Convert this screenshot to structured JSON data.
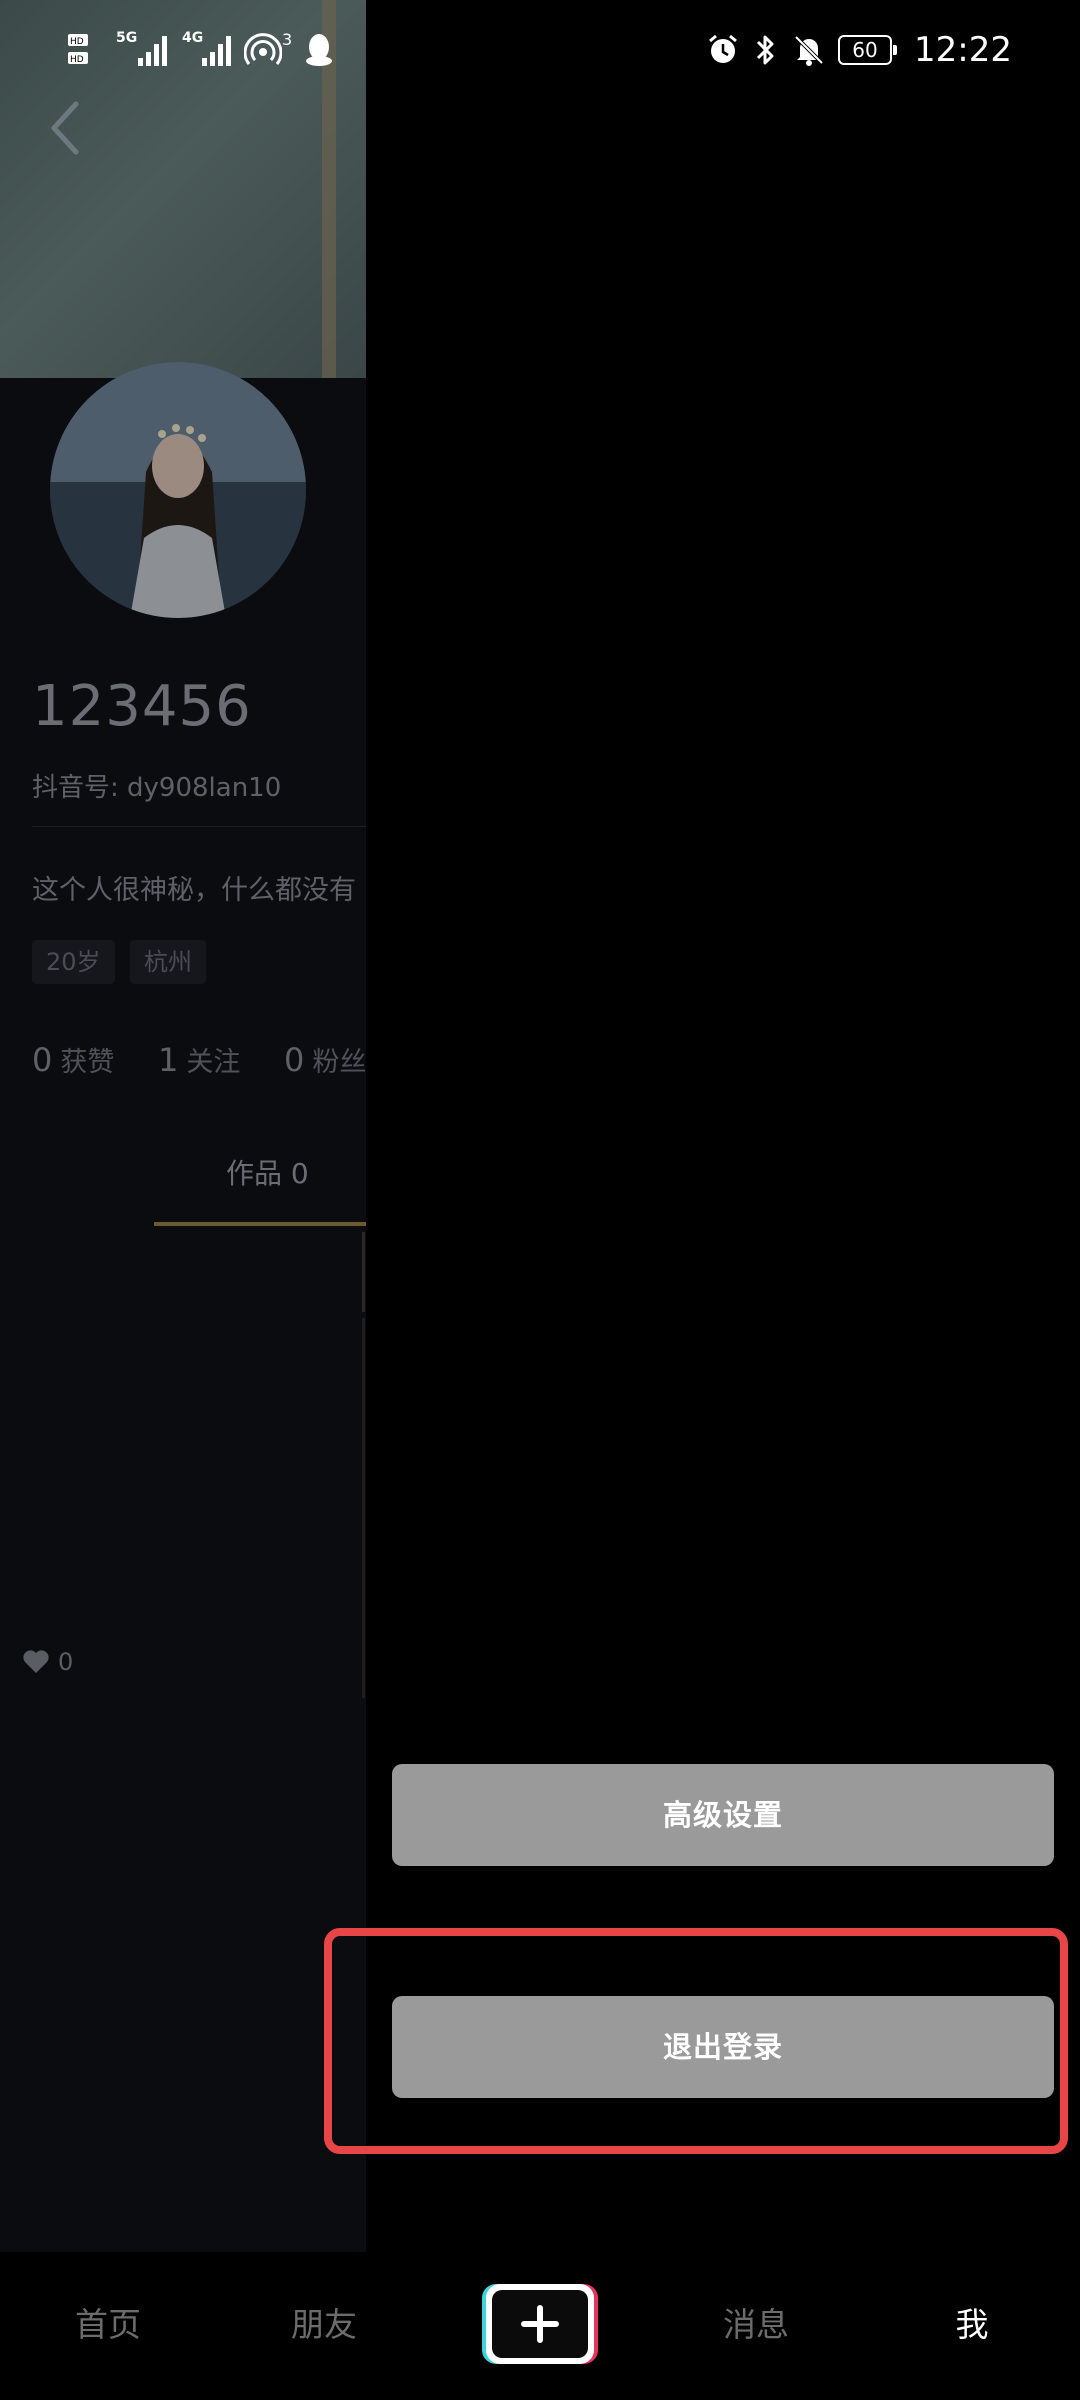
{
  "status_bar": {
    "time": "12:22",
    "battery": "60",
    "network_1": "5G",
    "network_2": "4G",
    "hotspot_count": "3"
  },
  "profile": {
    "username": "123456",
    "douyin_id": "抖音号: dy908lan10",
    "bio": "这个人很神秘，什么都没有",
    "tags": [
      "20岁",
      "杭州"
    ],
    "stats": [
      {
        "num": "0",
        "label": "获赞"
      },
      {
        "num": "1",
        "label": "关注"
      },
      {
        "num": "0",
        "label": "粉丝"
      }
    ],
    "works_tab": "作品 0",
    "like_count": "0"
  },
  "drawer": {
    "advanced_settings": "高级设置",
    "logout": "退出登录"
  },
  "bottom_nav": {
    "home": "首页",
    "friends": "朋友",
    "messages": "消息",
    "me": "我"
  },
  "colors": {
    "highlight": "#e84646",
    "drawer_button": "#9a9a9a",
    "works_underline": "#6e5a31"
  }
}
